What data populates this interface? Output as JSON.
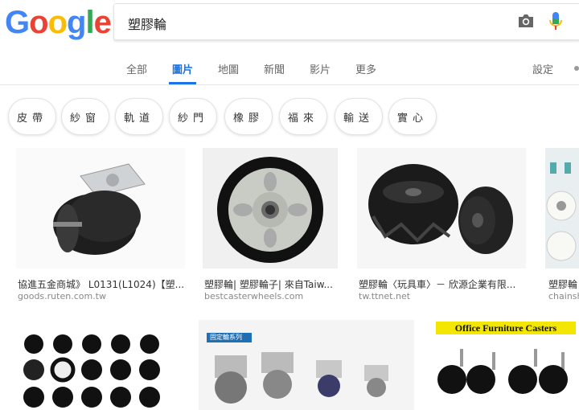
{
  "logo": {
    "letters": [
      "G",
      "o",
      "o",
      "g",
      "l",
      "e"
    ],
    "colors": [
      "#4285F4",
      "#EA4335",
      "#FBBC05",
      "#4285F4",
      "#34A853",
      "#EA4335"
    ]
  },
  "search": {
    "query": "塑膠輪"
  },
  "tabs": [
    {
      "label": "全部"
    },
    {
      "label": "圖片"
    },
    {
      "label": "地圖"
    },
    {
      "label": "新聞"
    },
    {
      "label": "影片"
    },
    {
      "label": "更多"
    }
  ],
  "settings_label": "設定",
  "chips": [
    "皮帶",
    "紗窗",
    "軌道",
    "紗門",
    "橡膠",
    "福來",
    "輸送",
    "實心"
  ],
  "results": [
    {
      "title": "協進五金商城》 L0131(L1024)【塑...",
      "source": "goods.ruten.com.tw"
    },
    {
      "title": "塑膠輪| 塑膠輪子| 來自Taiw...",
      "source": "bestcasterwheels.com"
    },
    {
      "title": "塑膠輪〈玩具車〉－ 欣源企業有限...",
      "source": "tw.ttnet.net"
    },
    {
      "title": "塑膠輪",
      "source": "chainsh"
    }
  ],
  "row2": {
    "img2_caption": "固定輪系列",
    "img3_caption": "Office Furniture Casters"
  },
  "accent": "#1a73e8"
}
